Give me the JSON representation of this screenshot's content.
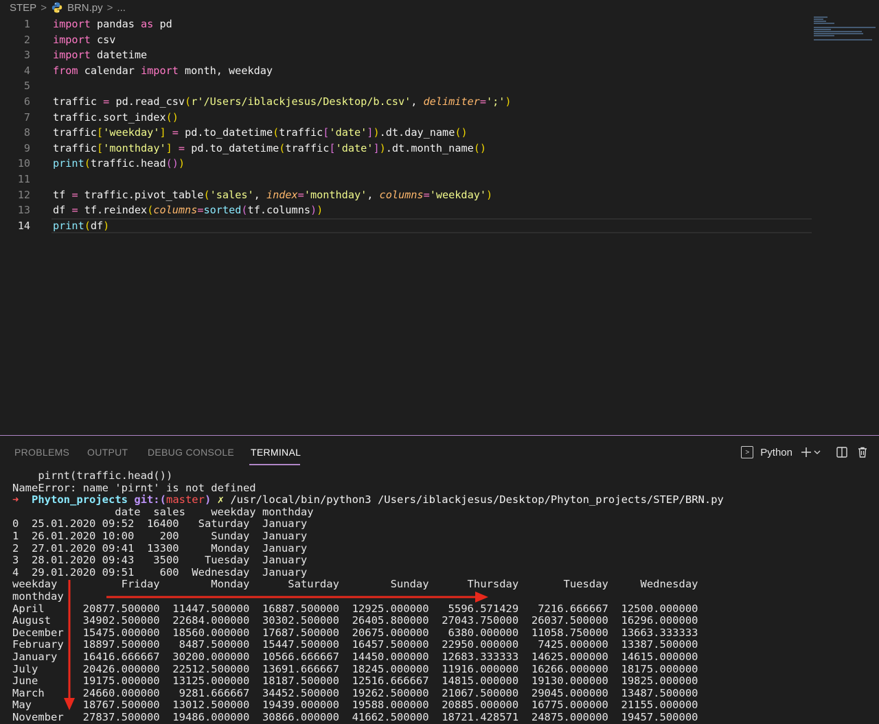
{
  "breadcrumb": {
    "folder": "STEP",
    "file": "BRN.py",
    "ellipsis": "..."
  },
  "editor": {
    "active_line": 14,
    "lines": [
      {
        "n": "1",
        "tokens": [
          [
            "kw",
            "import"
          ],
          [
            "plain",
            " pandas "
          ],
          [
            "kw",
            "as"
          ],
          [
            "plain",
            " pd"
          ]
        ]
      },
      {
        "n": "2",
        "tokens": [
          [
            "kw",
            "import"
          ],
          [
            "plain",
            " csv"
          ]
        ]
      },
      {
        "n": "3",
        "tokens": [
          [
            "kw",
            "import"
          ],
          [
            "plain",
            " datetime"
          ]
        ]
      },
      {
        "n": "4",
        "tokens": [
          [
            "kw",
            "from"
          ],
          [
            "plain",
            " calendar "
          ],
          [
            "kw",
            "import"
          ],
          [
            "plain",
            " month, weekday"
          ]
        ]
      },
      {
        "n": "5",
        "tokens": []
      },
      {
        "n": "6",
        "tokens": [
          [
            "plain",
            "traffic "
          ],
          [
            "op",
            "="
          ],
          [
            "plain",
            " pd.read_csv"
          ],
          [
            "par1",
            "("
          ],
          [
            "str",
            "r'/Users/iblackjesus/Desktop/b.csv'"
          ],
          [
            "plain",
            ", "
          ],
          [
            "prm",
            "delimiter"
          ],
          [
            "op",
            "="
          ],
          [
            "str",
            "';'"
          ],
          [
            "par1",
            ")"
          ]
        ]
      },
      {
        "n": "7",
        "tokens": [
          [
            "plain",
            "traffic.sort_index"
          ],
          [
            "par1",
            "()"
          ]
        ]
      },
      {
        "n": "8",
        "tokens": [
          [
            "plain",
            "traffic"
          ],
          [
            "par1",
            "["
          ],
          [
            "str",
            "'weekday'"
          ],
          [
            "par1",
            "]"
          ],
          [
            "plain",
            " "
          ],
          [
            "op",
            "="
          ],
          [
            "plain",
            " pd.to_datetime"
          ],
          [
            "par1",
            "("
          ],
          [
            "plain",
            "traffic"
          ],
          [
            "par2",
            "["
          ],
          [
            "str",
            "'date'"
          ],
          [
            "par2",
            "]"
          ],
          [
            "par1",
            ")"
          ],
          [
            "plain",
            ".dt.day_name"
          ],
          [
            "par1",
            "()"
          ]
        ]
      },
      {
        "n": "9",
        "tokens": [
          [
            "plain",
            "traffic"
          ],
          [
            "par1",
            "["
          ],
          [
            "str",
            "'monthday'"
          ],
          [
            "par1",
            "]"
          ],
          [
            "plain",
            " "
          ],
          [
            "op",
            "="
          ],
          [
            "plain",
            " pd.to_datetime"
          ],
          [
            "par1",
            "("
          ],
          [
            "plain",
            "traffic"
          ],
          [
            "par2",
            "["
          ],
          [
            "str",
            "'date'"
          ],
          [
            "par2",
            "]"
          ],
          [
            "par1",
            ")"
          ],
          [
            "plain",
            ".dt.month_name"
          ],
          [
            "par1",
            "()"
          ]
        ]
      },
      {
        "n": "10",
        "tokens": [
          [
            "blt",
            "print"
          ],
          [
            "par1",
            "("
          ],
          [
            "plain",
            "traffic.head"
          ],
          [
            "par2",
            "()"
          ],
          [
            "par1",
            ")"
          ]
        ]
      },
      {
        "n": "11",
        "tokens": []
      },
      {
        "n": "12",
        "tokens": [
          [
            "plain",
            "tf "
          ],
          [
            "op",
            "="
          ],
          [
            "plain",
            " traffic.pivot_table"
          ],
          [
            "par1",
            "("
          ],
          [
            "str",
            "'sales'"
          ],
          [
            "plain",
            ", "
          ],
          [
            "prm",
            "index"
          ],
          [
            "op",
            "="
          ],
          [
            "str",
            "'monthday'"
          ],
          [
            "plain",
            ", "
          ],
          [
            "prm",
            "columns"
          ],
          [
            "op",
            "="
          ],
          [
            "str",
            "'weekday'"
          ],
          [
            "par1",
            ")"
          ]
        ]
      },
      {
        "n": "13",
        "tokens": [
          [
            "plain",
            "df "
          ],
          [
            "op",
            "="
          ],
          [
            "plain",
            " tf.reindex"
          ],
          [
            "par1",
            "("
          ],
          [
            "prm",
            "columns"
          ],
          [
            "op",
            "="
          ],
          [
            "blt",
            "sorted"
          ],
          [
            "par2",
            "("
          ],
          [
            "plain",
            "tf.columns"
          ],
          [
            "par2",
            ")"
          ],
          [
            "par1",
            ")"
          ]
        ]
      },
      {
        "n": "14",
        "tokens": [
          [
            "blt",
            "print"
          ],
          [
            "par1",
            "("
          ],
          [
            "plain",
            "df"
          ],
          [
            "par1",
            ")"
          ]
        ]
      }
    ]
  },
  "panel": {
    "tabs": [
      {
        "label": "PROBLEMS",
        "active": false
      },
      {
        "label": "OUTPUT",
        "active": false
      },
      {
        "label": "DEBUG CONSOLE",
        "active": false
      },
      {
        "label": "TERMINAL",
        "active": true
      }
    ],
    "shell_label": "Python"
  },
  "terminal": {
    "lines": [
      "    pirnt(traffic.head())",
      "NameError: name 'pirnt' is not defined",
      "",
      "                date  sales    weekday monthday",
      "0  25.01.2020 09:52  16400   Saturday  January",
      "1  26.01.2020 10:00    200     Sunday  January",
      "2  27.01.2020 09:41  13300     Monday  January",
      "3  28.01.2020 09:43   3500    Tuesday  January",
      "4  29.01.2020 09:51    600  Wednesday  January",
      "weekday          Friday        Monday      Saturday        Sunday      Thursday       Tuesday     Wednesday",
      "monthday",
      "April      20877.500000  11447.500000  16887.500000  12925.000000   5596.571429   7216.666667  12500.000000",
      "August     34902.500000  22684.000000  30302.500000  26405.800000  27043.750000  26037.500000  16296.000000",
      "December   15475.000000  18560.000000  17687.500000  20675.000000   6380.000000  11058.750000  13663.333333",
      "February   18897.500000   8487.500000  15447.500000  16457.500000  22950.000000   7425.000000  13387.500000",
      "January    16416.666667  30200.000000  10566.666667  14450.000000  12683.333333  14625.000000  14615.000000",
      "July       20426.000000  22512.500000  13691.666667  18245.000000  11916.000000  16266.000000  18175.000000",
      "June       19175.000000  13125.000000  18187.500000  12516.666667  14815.000000  19130.000000  19825.000000",
      "March      24660.000000   9281.666667  34452.500000  19262.500000  21067.500000  29045.000000  13487.500000",
      "May        18767.500000  13012.500000  19439.000000  19588.000000  20885.000000  16775.000000  21155.000000",
      "November   27837.500000  19486.000000  30866.000000  41662.500000  18721.428571  24875.000000  19457.500000"
    ],
    "prompt": {
      "arrow": "➜",
      "dir": "Phyton_projects",
      "git": "git:(",
      "branch": "master",
      "git_close": ")",
      "dirty": "✗",
      "command": "/usr/local/bin/python3 /Users/iblackjesus/Desktop/Phyton_projects/STEP/BRN.py"
    },
    "prompt_line_index": 2
  },
  "colors": {
    "annotation_arrow": "#e8291c",
    "panel_border": "#b086c7"
  }
}
